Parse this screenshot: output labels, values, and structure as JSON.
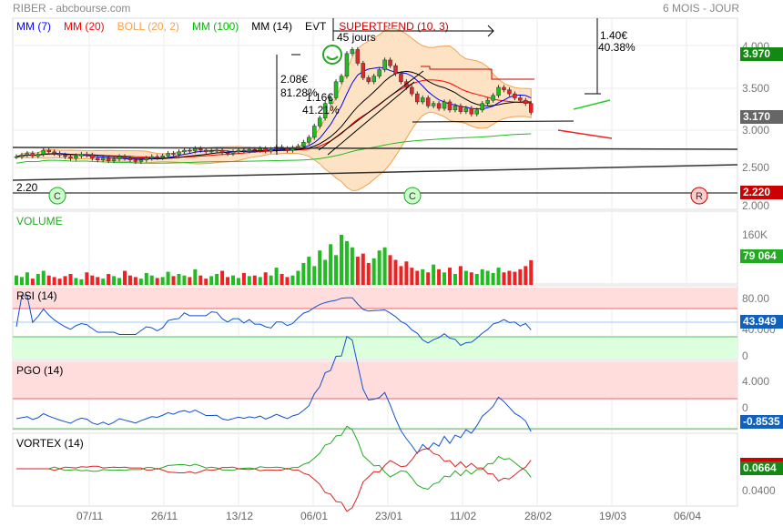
{
  "header": {
    "title": "RIBER - abcbourse.com",
    "period": "6 MOIS - JOUR"
  },
  "legend": [
    {
      "label": "MM (7)",
      "color": "#0000ff"
    },
    {
      "label": "MM (20)",
      "color": "#ff0000"
    },
    {
      "label": "BOLL (20, 2)",
      "color": "#ffa040"
    },
    {
      "label": "MM (100)",
      "color": "#00bb00"
    },
    {
      "label": "MM (14)",
      "color": "#000000"
    },
    {
      "label": "EVT",
      "color": "#000000"
    },
    {
      "label": "SUPERTREND (10, 3)",
      "color": "#cc0000"
    }
  ],
  "annotations": {
    "days": "45 jours",
    "gain1": "2.08€",
    "gain1pct": "81.28%",
    "gain2": "1.16€",
    "gain2pct": "41.21%",
    "gain3": "1.40€",
    "gain3pct": "40.38%",
    "support": "2.20",
    "markers": [
      "C",
      "C",
      "R"
    ]
  },
  "panels": {
    "volume": "VOLUME",
    "rsi": "RSI (14)",
    "pgo": "PGO (14)",
    "vortex": "VORTEX (14)"
  },
  "axis": {
    "price": [
      "4.000",
      "3.500",
      "3.000",
      "2.500",
      "2.000"
    ],
    "volume": [
      "160K"
    ],
    "rsi": [
      "80.00",
      "40.000",
      "0"
    ],
    "pgo": [
      "4.000",
      "0"
    ],
    "vortex": [
      "0.0400"
    ],
    "dates": [
      "07/11",
      "26/11",
      "13/12",
      "06/01",
      "23/01",
      "11/02",
      "28/02",
      "19/03",
      "06/04"
    ]
  },
  "tags": {
    "high": "3.970",
    "last": "3.170",
    "low": "2.220",
    "volume": "79 064",
    "rsi": "43.949",
    "pgo": "-0.8535",
    "vortex": "0.0664"
  },
  "colors": {
    "up": "#22bb22",
    "down": "#ee2222",
    "high": "#138813",
    "last": "#666666",
    "low": "#cc0000",
    "blue": "#1060c0"
  },
  "chart_data": {
    "type": "candlestick",
    "title": "RIBER",
    "ylim": [
      2.0,
      4.0
    ],
    "closes": [
      2.62,
      2.64,
      2.66,
      2.63,
      2.65,
      2.7,
      2.68,
      2.66,
      2.64,
      2.62,
      2.6,
      2.63,
      2.65,
      2.64,
      2.6,
      2.58,
      2.6,
      2.57,
      2.59,
      2.62,
      2.6,
      2.58,
      2.56,
      2.58,
      2.6,
      2.62,
      2.61,
      2.63,
      2.66,
      2.65,
      2.68,
      2.7,
      2.69,
      2.72,
      2.7,
      2.68,
      2.69,
      2.7,
      2.67,
      2.66,
      2.68,
      2.7,
      2.69,
      2.71,
      2.7,
      2.72,
      2.69,
      2.71,
      2.74,
      2.72,
      2.7,
      2.73,
      2.75,
      2.8,
      2.86,
      3.0,
      3.1,
      3.28,
      3.35,
      3.55,
      3.62,
      3.9,
      3.95,
      3.78,
      3.6,
      3.55,
      3.62,
      3.7,
      3.82,
      3.75,
      3.65,
      3.55,
      3.48,
      3.4,
      3.3,
      3.35,
      3.25,
      3.28,
      3.22,
      3.3,
      3.2,
      3.25,
      3.18,
      3.22,
      3.15,
      3.2,
      3.28,
      3.32,
      3.38,
      3.48,
      3.45,
      3.4,
      3.35,
      3.32,
      3.28,
      3.17
    ],
    "volumes_k": [
      30,
      25,
      40,
      20,
      35,
      45,
      30,
      25,
      20,
      28,
      35,
      22,
      18,
      40,
      30,
      25,
      20,
      35,
      28,
      22,
      45,
      30,
      25,
      20,
      38,
      30,
      22,
      25,
      42,
      28,
      35,
      30,
      25,
      50,
      30,
      20,
      28,
      35,
      45,
      25,
      30,
      22,
      38,
      28,
      30,
      25,
      40,
      30,
      55,
      35,
      25,
      30,
      45,
      70,
      90,
      60,
      110,
      80,
      130,
      95,
      160,
      140,
      120,
      90,
      100,
      70,
      85,
      110,
      120,
      95,
      80,
      60,
      75,
      55,
      45,
      50,
      40,
      65,
      50,
      40,
      55,
      35,
      60,
      45,
      40,
      35,
      50,
      45,
      38,
      55,
      40,
      45,
      42,
      50,
      60,
      79
    ]
  }
}
